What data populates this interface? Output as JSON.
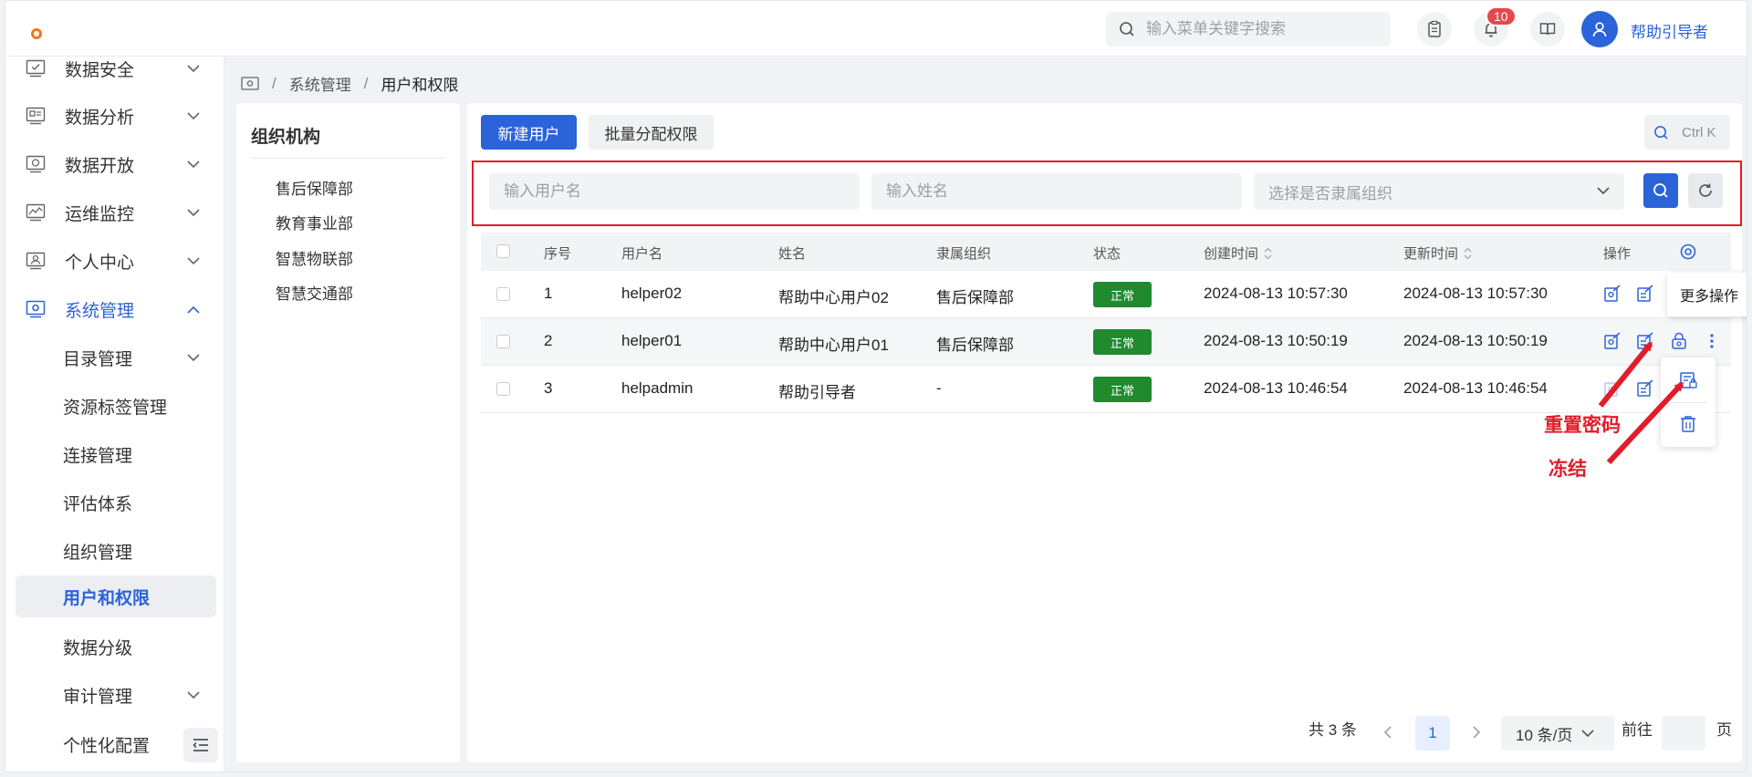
{
  "header": {
    "search_placeholder": "输入菜单关键字搜索",
    "notification_count": "10",
    "username": "帮助引导者"
  },
  "sidebar": {
    "items": [
      {
        "label": "数据安全",
        "icon": "checklist-icon"
      },
      {
        "label": "数据分析",
        "icon": "analytics-icon"
      },
      {
        "label": "数据开放",
        "icon": "open-data-icon"
      },
      {
        "label": "运维监控",
        "icon": "monitor-chart-icon"
      },
      {
        "label": "个人中心",
        "icon": "user-card-icon"
      },
      {
        "label": "系统管理",
        "icon": "system-settings-icon"
      }
    ],
    "sub_items": [
      {
        "label": "目录管理"
      },
      {
        "label": "资源标签管理"
      },
      {
        "label": "连接管理"
      },
      {
        "label": "评估体系"
      },
      {
        "label": "组织管理"
      },
      {
        "label": "用户和权限"
      },
      {
        "label": "数据分级"
      },
      {
        "label": "审计管理"
      },
      {
        "label": "个性化配置"
      }
    ]
  },
  "breadcrumb": {
    "items": [
      "系统管理",
      "用户和权限"
    ]
  },
  "org": {
    "title": "组织机构",
    "items": [
      "售后保障部",
      "教育事业部",
      "智慧物联部",
      "智慧交通部"
    ]
  },
  "toolbar": {
    "new_user": "新建用户",
    "batch_assign": "批量分配权限",
    "shortcut": "Ctrl K"
  },
  "filters": {
    "username_placeholder": "输入用户名",
    "name_placeholder": "输入姓名",
    "org_placeholder": "选择是否隶属组织"
  },
  "table": {
    "columns": [
      "序号",
      "用户名",
      "姓名",
      "隶属组织",
      "状态",
      "创建时间",
      "更新时间",
      "操作"
    ],
    "rows": [
      {
        "index": "1",
        "username": "helper02",
        "name": "帮助中心用户02",
        "org": "售后保障部",
        "status": "正常",
        "created": "2024-08-13 10:57:30",
        "updated": "2024-08-13 10:57:30"
      },
      {
        "index": "2",
        "username": "helper01",
        "name": "帮助中心用户01",
        "org": "售后保障部",
        "status": "正常",
        "created": "2024-08-13 10:50:19",
        "updated": "2024-08-13 10:50:19"
      },
      {
        "index": "3",
        "username": "helpadmin",
        "name": "帮助引导者",
        "org": "-",
        "status": "正常",
        "created": "2024-08-13 10:46:54",
        "updated": "2024-08-13 10:46:54"
      }
    ]
  },
  "tooltip": {
    "more_actions": "更多操作"
  },
  "annotations": {
    "reset_password": "重置密码",
    "freeze": "冻结"
  },
  "pagination": {
    "total": "共 3 条",
    "current_page": "1",
    "page_size": "10 条/页",
    "goto_label": "前往",
    "page_suffix": "页"
  },
  "colors": {
    "primary": "#2b63d9",
    "status_ok": "#1f8a2e",
    "annotation_red": "#e11d2a",
    "badge_red": "#e5484d"
  }
}
